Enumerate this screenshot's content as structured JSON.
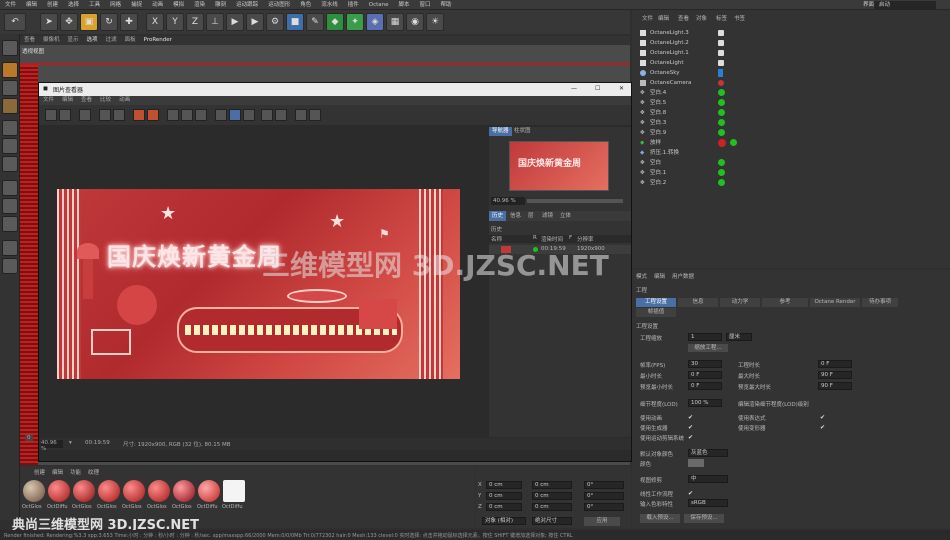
{
  "menu": [
    "文件",
    "编辑",
    "创建",
    "选择",
    "工具",
    "网格",
    "捕捉",
    "动画",
    "模拟",
    "渲染",
    "雕刻",
    "运动跟踪",
    "运动图形",
    "角色",
    "流水线",
    "插件",
    "Octane",
    "脚本",
    "窗口",
    "帮助"
  ],
  "layout": {
    "label": "界面:",
    "value": "启动"
  },
  "toolbar": {
    "x": "X",
    "y": "Y",
    "z": "Z"
  },
  "viewport": {
    "menu": [
      "查看",
      "摄像机",
      "显示",
      "选项",
      "过滤",
      "面板",
      "ProRender"
    ],
    "title": "透视视图"
  },
  "pic_viewer": {
    "title": "图片查看器",
    "menu": [
      "文件",
      "编辑",
      "查看",
      "比较",
      "动画"
    ],
    "render_text": "国庆焕新黄金周",
    "status": {
      "zoom": "40.96 %",
      "time": "00:19:59",
      "size": "尺寸: 1920x900, RGB (32 位), 80.15 MB",
      "frame": "0"
    },
    "nav_tabs": [
      "导航器",
      "柱状图"
    ],
    "zoom": "40.96 %",
    "history_tabs": [
      "历史",
      "信息",
      "层",
      "滤镜",
      "立体"
    ],
    "history_label": "历史",
    "history_headers": [
      "名称",
      "R",
      "渲染时间",
      "F",
      "分辨率"
    ],
    "history_row": {
      "time": "00:19:59",
      "res": "1920x900"
    }
  },
  "object_manager": {
    "menu": [
      "文件",
      "编辑",
      "查看",
      "对象",
      "标签",
      "书签"
    ],
    "objects": [
      "OctaneLight.3",
      "OctaneLight.2",
      "OctaneLight.1",
      "OctaneLight",
      "OctaneSky",
      "OctaneCamera",
      "空白.4",
      "空白.5",
      "空白.8",
      "空白.3",
      "空白.9",
      "放样",
      "挤压.1.转换",
      "空白",
      "空白.1",
      "空白.2"
    ]
  },
  "watermark": {
    "center": "三维模型网 3D.JZSC.NET",
    "bottom": "典尚三维模型网 3D.JZSC.NET"
  },
  "attributes": {
    "menu": [
      "模式",
      "编辑",
      "用户数据"
    ],
    "header": "工程",
    "tabs": [
      "工程设置",
      "信息",
      "动力学",
      "参考",
      "Octane Render",
      "待办事项",
      "帧插值"
    ],
    "section": "工程设置",
    "scale_label": "工程缩放",
    "scale_value": "1",
    "scale_unit": "厘米",
    "scale_button": "缩放工程...",
    "fields": [
      {
        "label": "帧率(FPS)",
        "value": "30"
      },
      {
        "label": "最小时长",
        "value": "0 F"
      },
      {
        "label": "预览最小时长",
        "value": "0 F"
      },
      {
        "label": "细节程度(LOD)",
        "value": "100 %"
      }
    ],
    "fields_right": [
      {
        "label": "工程时长",
        "value": "0 F"
      },
      {
        "label": "最大时长",
        "value": "90 F"
      },
      {
        "label": "预览最大时长",
        "value": "90 F"
      }
    ],
    "lod_note": "编辑渲染细节程度(LOD)级别",
    "checks_left": [
      "使用动画",
      "使用生成器",
      "使用运动剪辑系统"
    ],
    "checks_right": [
      "使用表达式",
      "使用变形器"
    ],
    "color_label": "默认对象颜色",
    "color_value": "灰蓝色",
    "color2": "颜色",
    "clip_label": "视图修剪",
    "clip_value": "中",
    "linear": "线性工作流程",
    "input_profile": "输入色彩特性",
    "input_value": "sRGB",
    "btn_load": "载入预设...",
    "btn_save": "保存预设..."
  },
  "materials": {
    "menu": [
      "创建",
      "编辑",
      "功能",
      "纹理"
    ],
    "labels": [
      "OctGlos",
      "OctDiffu",
      "OctGlos",
      "OctGlos",
      "OctGlos",
      "OctGlos",
      "OctGlos",
      "OctDiffu",
      "OctDiffu"
    ]
  },
  "coords": {
    "labels": [
      "X",
      "Y",
      "Z"
    ],
    "vals": [
      "0 cm",
      "0 cm",
      "0 cm"
    ],
    "sizes": [
      "0 cm",
      "0 cm",
      "0 cm"
    ],
    "angles": [
      "0°",
      "0°",
      "0°"
    ],
    "mode": "对象 (相对)",
    "size_mode": "绝对尺寸",
    "apply": "应用"
  },
  "status_bar": "Render finished: Rendering:%3.3 spp:3.653 Time:小时 : 分钟 : 秒/小时 : 分钟 : 秒/sec. spp/maxspp:66/2000 Mem:0/0/0Mb Tri:0/772302 hair:0 Mesh:133 clevel:0   实时选择: 点击并拖动鼠标选择元素。按住 SHIFT 键增加选择对象; 按住 CTRL"
}
